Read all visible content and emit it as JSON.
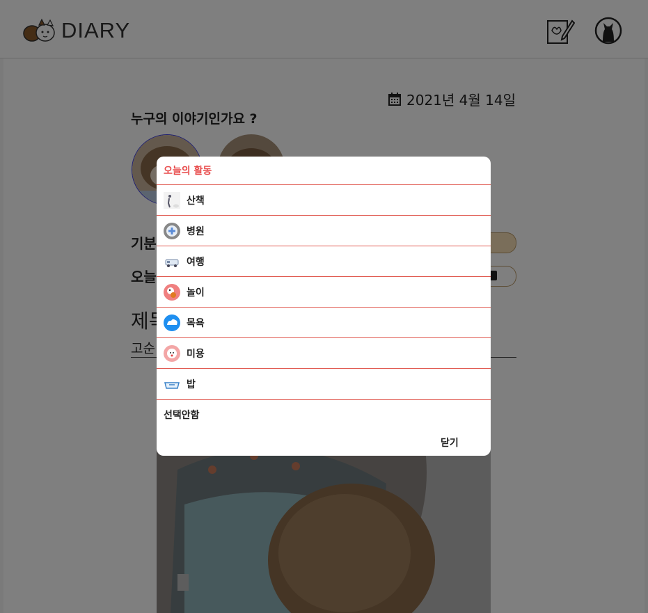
{
  "header": {
    "logo_text": "DIARY"
  },
  "diary": {
    "date": "2021년 4월 14일",
    "who_title": "누구의 이야기인가요 ?",
    "mood_label": "기분",
    "activity_label": "오늘",
    "title_label": "제목",
    "title_value": "고순"
  },
  "modal": {
    "title": "오늘의 활동",
    "items": [
      {
        "label": "산책",
        "icon": "walk-icon"
      },
      {
        "label": "병원",
        "icon": "hospital-icon"
      },
      {
        "label": "여행",
        "icon": "travel-icon"
      },
      {
        "label": "놀이",
        "icon": "play-icon"
      },
      {
        "label": "목욕",
        "icon": "bath-icon"
      },
      {
        "label": "미용",
        "icon": "grooming-icon"
      },
      {
        "label": "밥",
        "icon": "meal-icon"
      }
    ],
    "none_label": "선택안함",
    "close_label": "닫기"
  },
  "colors": {
    "accent": "#e84b4b",
    "overlay": "rgba(0,0,0,0.5)",
    "mood_pill": "#f5ddb4"
  }
}
